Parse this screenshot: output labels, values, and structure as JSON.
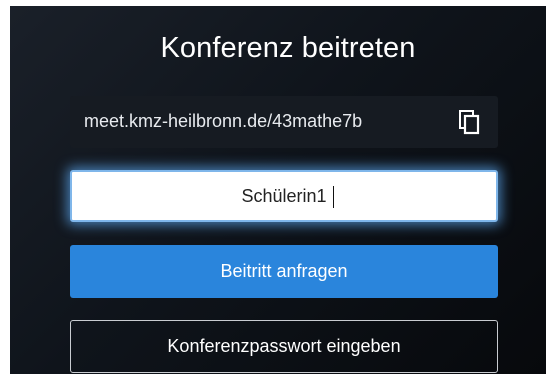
{
  "dialog": {
    "title": "Konferenz beitreten",
    "meeting_url": "meet.kmz-heilbronn.de/43mathe7b",
    "copy_icon": "copy-icon",
    "name_input": {
      "value": "Schülerin1",
      "focus_color": "#5aa0e6"
    },
    "join_button_label": "Beitritt anfragen",
    "password_button_label": "Konferenzpasswort eingeben"
  },
  "colors": {
    "background": "#0f141b",
    "primary": "#2a85dc",
    "text": "#ffffff"
  }
}
